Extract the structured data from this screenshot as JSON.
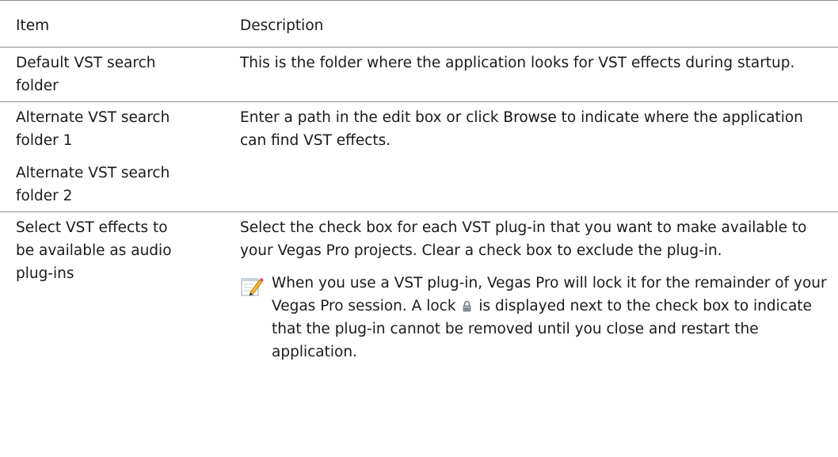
{
  "table": {
    "header": {
      "item": "Item",
      "description": "Description"
    },
    "rows": [
      {
        "item_lines": [
          "Default VST search",
          "folder"
        ],
        "description": "This is the folder where the application looks for VST effects during startup."
      },
      {
        "item_lines": [
          "Alternate VST search",
          "folder 1"
        ],
        "item2_lines": [
          "Alternate VST search",
          "folder 2"
        ],
        "description_before": "Enter a path in the edit box or click ",
        "description_bold": "Browse",
        "description_after": " to indicate where the application can find VST effects."
      },
      {
        "item_lines": [
          "Select VST effects to",
          "be available as audio",
          "plug-ins"
        ],
        "description": "Select the check box for each VST plug-in that you want to make available to your Vegas Pro projects. Clear a check box to exclude the plug-in.",
        "note_before": "When you use a VST plug-in, Vegas Pro will lock it for the remainder of your Vegas Pro session. A lock ",
        "note_after": " is displayed next to the check box to indicate that the plug-in cannot be removed until you close and restart the application.",
        "note_icon": "note-pencil-icon",
        "inline_icon": "lock-icon"
      }
    ]
  }
}
